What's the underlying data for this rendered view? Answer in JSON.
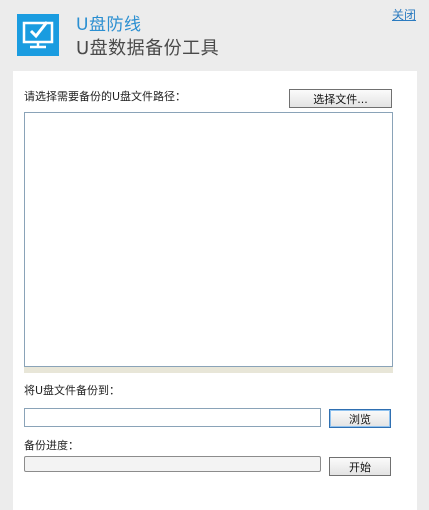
{
  "header": {
    "title": "U盘防线",
    "subtitle": "U盘数据备份工具",
    "close_label": "关闭",
    "logo_icon": "monitor-check-icon",
    "accent_color": "#1a9ce0"
  },
  "file_select": {
    "prompt": "请选择需要备份的U盘文件路径：",
    "choose_button": "选择文件...",
    "items": []
  },
  "destination": {
    "label": "将U盘文件备份到：",
    "path_value": "",
    "browse_button": "浏览"
  },
  "progress": {
    "label": "备份进度：",
    "percent": 0,
    "start_button": "开始"
  }
}
